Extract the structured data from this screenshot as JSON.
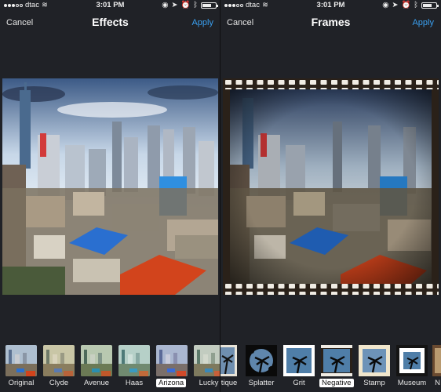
{
  "status": {
    "carrier": "dtac",
    "time": "3:01 PM"
  },
  "left": {
    "nav": {
      "cancel": "Cancel",
      "title": "Effects",
      "apply": "Apply"
    },
    "effects": [
      {
        "label": "Original",
        "selected": false
      },
      {
        "label": "Clyde",
        "selected": false
      },
      {
        "label": "Avenue",
        "selected": false
      },
      {
        "label": "Haas",
        "selected": false
      },
      {
        "label": "Arizona",
        "selected": true
      },
      {
        "label": "Lucky",
        "selected": false
      }
    ]
  },
  "right": {
    "nav": {
      "cancel": "Cancel",
      "title": "Frames",
      "apply": "Apply"
    },
    "frames": [
      {
        "label": "tique",
        "selected": false
      },
      {
        "label": "Splatter",
        "selected": false
      },
      {
        "label": "Grit",
        "selected": false
      },
      {
        "label": "Negative",
        "selected": true
      },
      {
        "label": "Stamp",
        "selected": false
      },
      {
        "label": "Museum",
        "selected": false
      },
      {
        "label": "N",
        "selected": false
      }
    ]
  },
  "colors": {
    "accent": "#3aa0f0",
    "background": "#202227",
    "text": "#e6e6e6"
  }
}
